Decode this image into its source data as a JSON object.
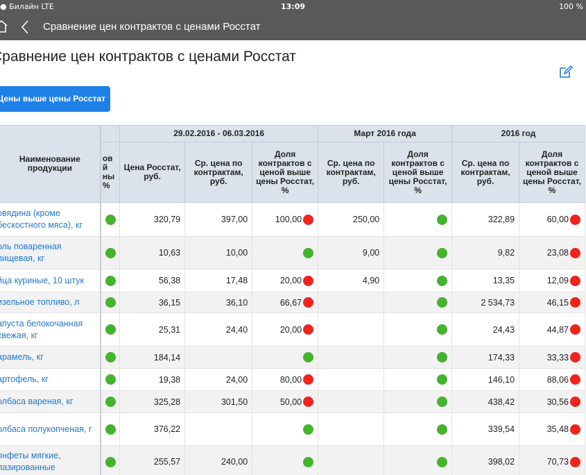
{
  "status": {
    "carrier": "● Билайн  LTE",
    "time": "13:09",
    "battery": "100 %"
  },
  "nav": {
    "title": "Сравнение цен контрактов с ценами Росстат"
  },
  "page": {
    "title": "Сравнение цен контрактов с ценами Росстат",
    "filter_button": "Цены выше цены Росстат"
  },
  "table": {
    "groups": [
      "29.02.2016 - 06.03.2016",
      "Март 2016 года",
      "2016 год"
    ],
    "name_header": "Наименование продукции",
    "clipped_header": [
      "ов",
      "й",
      "ны",
      "%"
    ],
    "col_headers": {
      "rosstat": "Цена Росстат, руб.",
      "avg": "Ср. цена по контрактам, руб.",
      "share": "Доля контрактов с ценой выше цены Росстат, %"
    },
    "rows": [
      {
        "name": "овядина (кроме бескостного мяса), кг",
        "c0": "green",
        "rosstat": "320,79",
        "avg1": "397,00",
        "share1": "100,00",
        "s1": "red",
        "avg2": "250,00",
        "s2": "green",
        "avg3": "322,89",
        "share3": "60,00",
        "s3": "red"
      },
      {
        "name": "оль поваренная пищевая, кг",
        "c0": "green",
        "rosstat": "10,63",
        "avg1": "10,00",
        "share1": "",
        "s1": "green",
        "avg2": "9,00",
        "s2": "green",
        "avg3": "9,82",
        "share3": "23,08",
        "s3": "red"
      },
      {
        "name": "йца куриные, 10 штук",
        "c0": "green",
        "rosstat": "56,38",
        "avg1": "17,48",
        "share1": "20,00",
        "s1": "red",
        "avg2": "4,90",
        "s2": "green",
        "avg3": "13,35",
        "share3": "12,09",
        "s3": "red"
      },
      {
        "name": "изельное топливо, л",
        "c0": "green",
        "rosstat": "36,15",
        "avg1": "36,10",
        "share1": "66,67",
        "s1": "red",
        "avg2": "",
        "s2": "green",
        "avg3": "2 534,73",
        "share3": "46,15",
        "s3": "red"
      },
      {
        "name": "апуста белокочанная свежая, кг",
        "c0": "green",
        "rosstat": "25,31",
        "avg1": "24,40",
        "share1": "20,00",
        "s1": "red",
        "avg2": "",
        "s2": "green",
        "avg3": "24,43",
        "share3": "44,87",
        "s3": "red"
      },
      {
        "name": "арамель, кг",
        "c0": "green",
        "rosstat": "184,14",
        "avg1": "",
        "share1": "",
        "s1": "green",
        "avg2": "",
        "s2": "green",
        "avg3": "174,33",
        "share3": "33,33",
        "s3": "red"
      },
      {
        "name": "артофель, кг",
        "c0": "green",
        "rosstat": "19,38",
        "avg1": "24,00",
        "share1": "80,00",
        "s1": "red",
        "avg2": "",
        "s2": "green",
        "avg3": "146,10",
        "share3": "88,06",
        "s3": "red"
      },
      {
        "name": "олбаса вареная, кг",
        "c0": "green",
        "rosstat": "325,28",
        "avg1": "301,50",
        "share1": "50,00",
        "s1": "red",
        "avg2": "",
        "s2": "green",
        "avg3": "438,42",
        "share3": "30,56",
        "s3": "red"
      },
      {
        "name": "олбаса полукопченая, г",
        "c0": "green",
        "rosstat": "376,22",
        "avg1": "",
        "share1": "",
        "s1": "green",
        "avg2": "",
        "s2": "green",
        "avg3": "339,54",
        "share3": "35,48",
        "s3": "red"
      },
      {
        "name": "онфеты мягкие, лазированные",
        "c0": "green",
        "rosstat": "255,57",
        "avg1": "240,00",
        "share1": "",
        "s1": "green",
        "avg2": "",
        "s2": "green",
        "avg3": "398,02",
        "share3": "70,73",
        "s3": "red"
      }
    ]
  },
  "colors": {
    "nav_bg": "#595959",
    "button_bg": "#1f80e7",
    "link": "#2379cc",
    "green": "#44b32d",
    "red": "#f0241c",
    "header_bg": "#dce2ec"
  }
}
